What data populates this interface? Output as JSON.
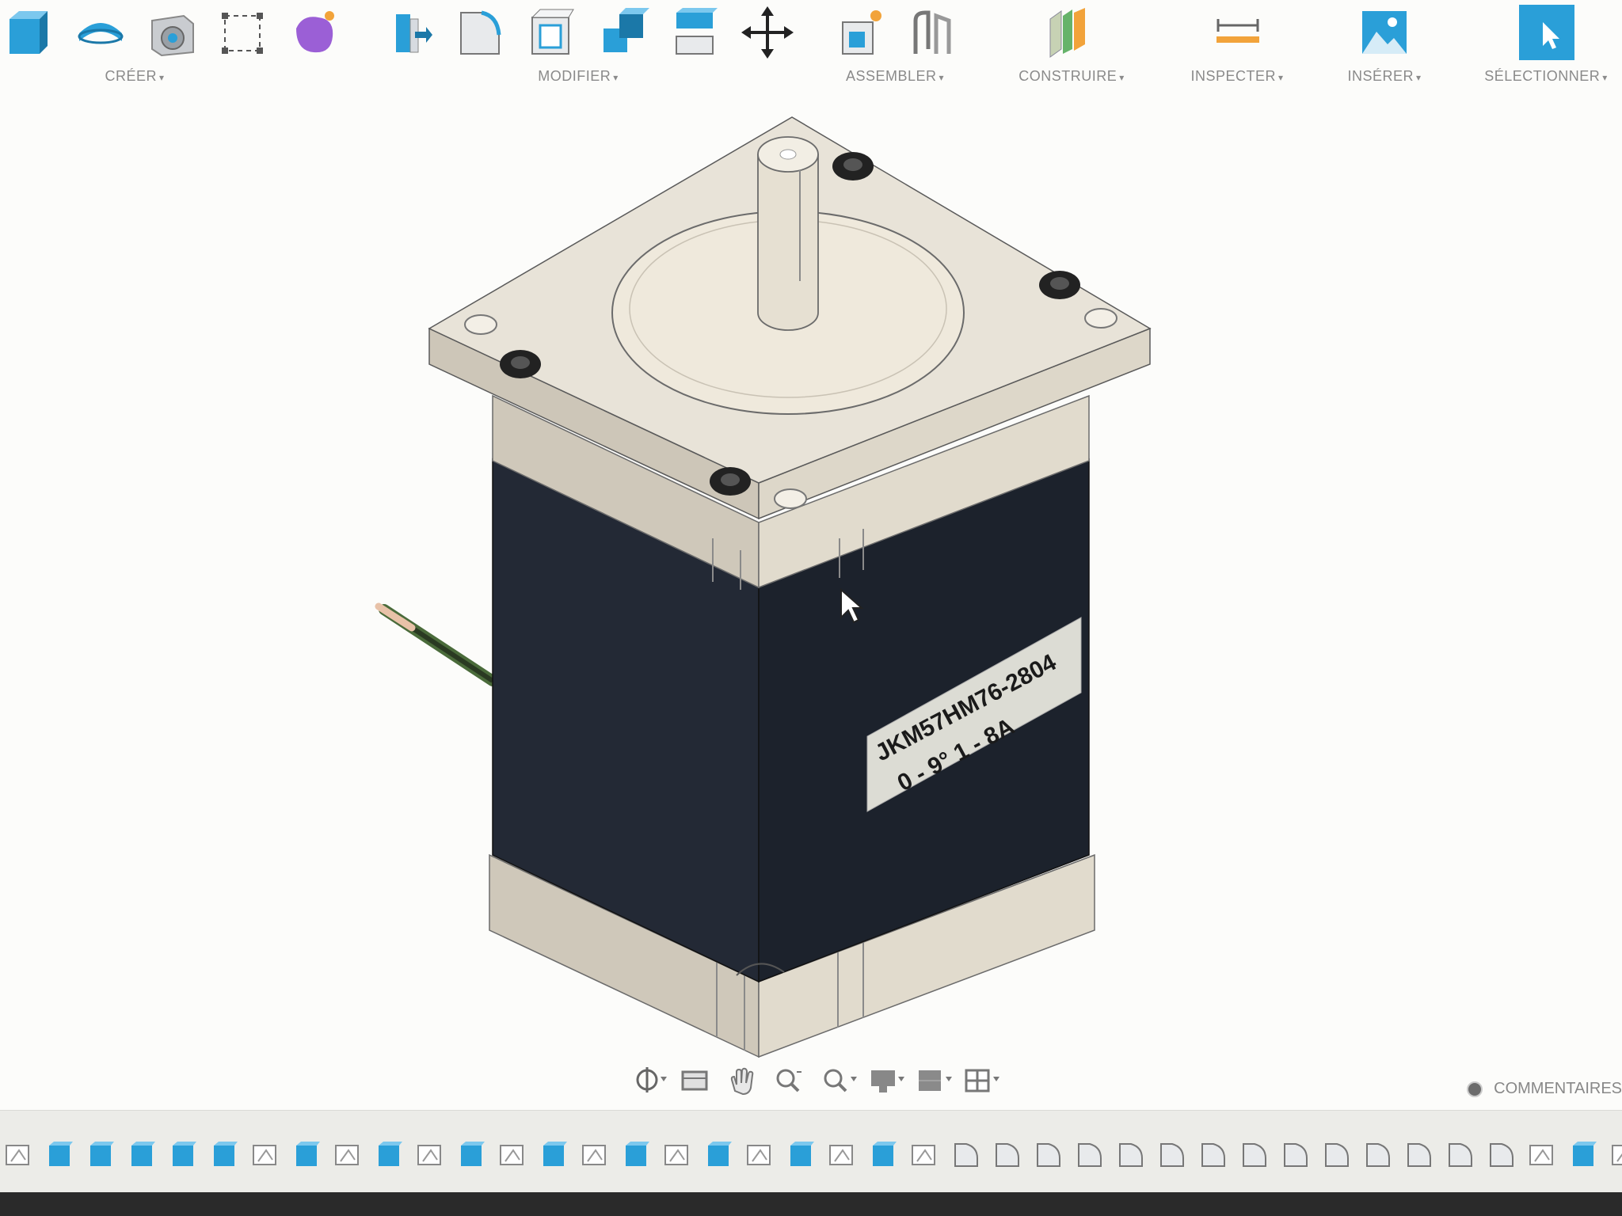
{
  "toolbar": {
    "groups": [
      {
        "id": "creer",
        "label": "CRÉER"
      },
      {
        "id": "modifier",
        "label": "MODIFIER"
      },
      {
        "id": "assembler",
        "label": "ASSEMBLER"
      },
      {
        "id": "construire",
        "label": "CONSTRUIRE"
      },
      {
        "id": "inspecter",
        "label": "INSPECTER"
      },
      {
        "id": "inserer",
        "label": "INSÉRER"
      },
      {
        "id": "selectionner",
        "label": "SÉLECTIONNER"
      }
    ],
    "tools": [
      {
        "name": "extrude-icon",
        "group": "creer"
      },
      {
        "name": "revolve-icon",
        "group": "creer"
      },
      {
        "name": "hole-icon",
        "group": "creer"
      },
      {
        "name": "box-select-icon",
        "group": "creer"
      },
      {
        "name": "form-icon",
        "group": "creer"
      },
      {
        "name": "press-pull-icon",
        "group": "modifier"
      },
      {
        "name": "fillet-icon",
        "group": "modifier"
      },
      {
        "name": "shell-icon",
        "group": "modifier"
      },
      {
        "name": "combine-icon",
        "group": "modifier"
      },
      {
        "name": "split-body-icon",
        "group": "modifier"
      },
      {
        "name": "move-icon",
        "group": "modifier"
      },
      {
        "name": "new-component-icon",
        "group": "assembler"
      },
      {
        "name": "joint-icon",
        "group": "assembler"
      },
      {
        "name": "plane-icon",
        "group": "construire"
      },
      {
        "name": "measure-icon",
        "group": "inspecter"
      },
      {
        "name": "insert-image-icon",
        "group": "inserer"
      },
      {
        "name": "select-icon",
        "group": "selectionner"
      }
    ]
  },
  "model": {
    "label_line1": "JKM57HM76-2804",
    "label_line2": "0 - 9°    1 - 8A"
  },
  "navbar": {
    "tools": [
      "orbit-icon",
      "look-at-icon",
      "pan-icon",
      "zoom-icon",
      "fit-icon",
      "display-settings-icon",
      "grid-settings-icon",
      "viewports-icon"
    ]
  },
  "comments": {
    "label": "COMMENTAIRES"
  },
  "timeline": {
    "items": [
      "sketch",
      "body",
      "body",
      "body",
      "body",
      "body",
      "sketch",
      "body",
      "sketch",
      "body",
      "sketch",
      "body",
      "sketch",
      "body",
      "sketch",
      "body",
      "sketch",
      "body",
      "sketch",
      "body",
      "sketch",
      "body",
      "sketch",
      "fillet",
      "fillet",
      "fillet",
      "fillet",
      "fillet",
      "fillet",
      "fillet",
      "fillet",
      "fillet",
      "fillet",
      "fillet",
      "fillet",
      "fillet",
      "fillet",
      "sketch",
      "body",
      "sketch",
      "body"
    ]
  },
  "colors": {
    "accent_blue": "#2a9fd8",
    "motor_body": "#1f2530",
    "motor_metal": "#d9d3c6",
    "label_bg": "#dcdcd4"
  }
}
